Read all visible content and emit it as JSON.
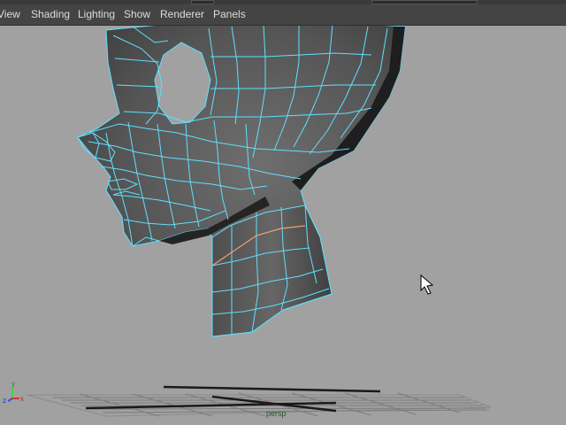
{
  "menu": {
    "items": [
      {
        "label": "View"
      },
      {
        "label": "Shading"
      },
      {
        "label": "Lighting"
      },
      {
        "label": "Show"
      },
      {
        "label": "Renderer"
      },
      {
        "label": "Panels"
      }
    ]
  },
  "viewport": {
    "camera_label": "persp",
    "axis": {
      "x": "x",
      "y": "y",
      "z": "z"
    }
  },
  "colors": {
    "viewport_bg": "#a1a1a1",
    "menubar_bg": "#444444",
    "menu_text": "#dcdcdc",
    "wireframe": "#5fe0ff",
    "selected_edge": "#f0a070",
    "camera_label": "#1f5a1f"
  }
}
